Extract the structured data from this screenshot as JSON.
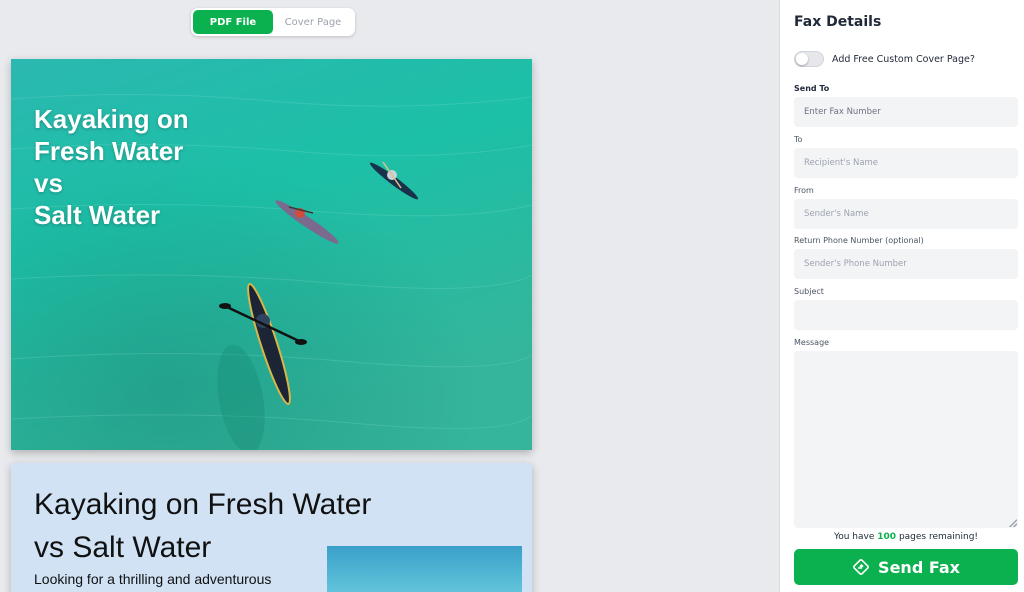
{
  "preview": {
    "tabs": [
      {
        "label": "PDF File",
        "active": true
      },
      {
        "label": "Cover Page",
        "active": false
      }
    ],
    "cover_page": {
      "title_lines": [
        "Kayaking on",
        "Fresh Water",
        "vs",
        "Salt Water"
      ]
    },
    "article_page": {
      "title_lines": [
        "Kayaking on Fresh Water",
        "vs Salt Water"
      ],
      "body_text": "Looking for a thrilling and adventurous"
    }
  },
  "fax_panel": {
    "title": "Fax Details",
    "cover_toggle": {
      "label": "Add Free Custom Cover Page?",
      "on": false
    },
    "fields": {
      "send_to": {
        "label": "Send To",
        "placeholder": "Enter Fax Number",
        "value": ""
      },
      "to": {
        "label": "To",
        "placeholder": "Recipient's Name",
        "value": ""
      },
      "from": {
        "label": "From",
        "placeholder": "Sender's Name",
        "value": ""
      },
      "return_phone": {
        "label": "Return Phone Number (optional)",
        "placeholder": "Sender's Phone Number",
        "value": ""
      },
      "subject": {
        "label": "Subject",
        "placeholder": "",
        "value": ""
      },
      "message": {
        "label": "Message",
        "placeholder": "",
        "value": ""
      }
    },
    "pages_remaining": {
      "prefix": "You have",
      "count": "100",
      "suffix": "pages remaining!"
    },
    "send_button": {
      "label": "Send Fax",
      "icon": "send-diamond-icon"
    }
  },
  "colors": {
    "accent": "#0cb14f",
    "panel_background": "#ffffff",
    "canvas_background": "#e8eaed",
    "water": "#1fb5a7",
    "article_background": "#d0e2f4"
  }
}
